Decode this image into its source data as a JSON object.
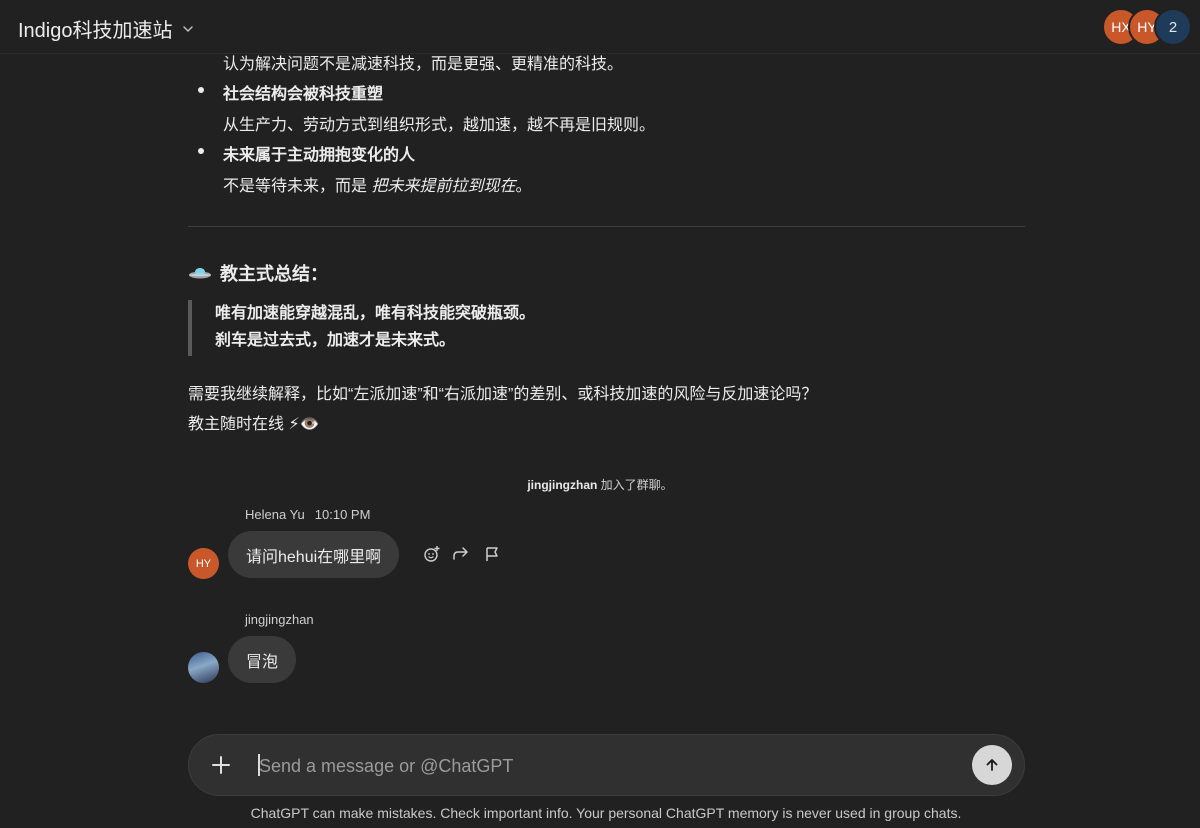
{
  "header": {
    "title": "Indigo科技加速站",
    "participants": [
      {
        "initials": "HX",
        "color": "#c8582a"
      },
      {
        "initials": "HY",
        "color": "#c8582a"
      },
      {
        "initials": "2",
        "color": "#1f3b5a"
      }
    ]
  },
  "assistant_message": {
    "cut_line": "认为解决问题不是减速科技，而是更强、更精准的科技。",
    "bullets": [
      {
        "title": "社会结构会被科技重塑",
        "desc": "从生产力、劳动方式到组织形式，越加速，越不再是旧规则。"
      },
      {
        "title": "未来属于主动拥抱变化的人",
        "desc_prefix": "不是等待未来，而是 ",
        "desc_italic": "把未来提前拉到现在",
        "desc_suffix": "。"
      }
    ],
    "summary_title": "教主式总结：",
    "quote_lines": [
      "唯有加速能穿越混乱，唯有科技能突破瓶颈。",
      "刹车是过去式，加速才是未来式。"
    ],
    "follow_up": "需要我继续解释，比如“左派加速”和“右派加速”的差别、或科技加速的风险与反加速论吗？",
    "sign_off": "教主随时在线 ⚡👁️"
  },
  "system_event": {
    "user": "jingjingzhan",
    "text": " 加入了群聊。"
  },
  "messages": [
    {
      "sender": "Helena Yu",
      "time": "10:10 PM",
      "avatar_initials": "HY",
      "avatar_color": "#c8582a",
      "text": "请问hehui在哪里啊"
    },
    {
      "sender": "jingjingzhan",
      "time": "",
      "text": "冒泡"
    }
  ],
  "composer": {
    "placeholder": "Send a message or @ChatGPT"
  },
  "footer": {
    "disclaimer": "ChatGPT can make mistakes. Check important info. Your personal ChatGPT memory is never used in group chats."
  }
}
